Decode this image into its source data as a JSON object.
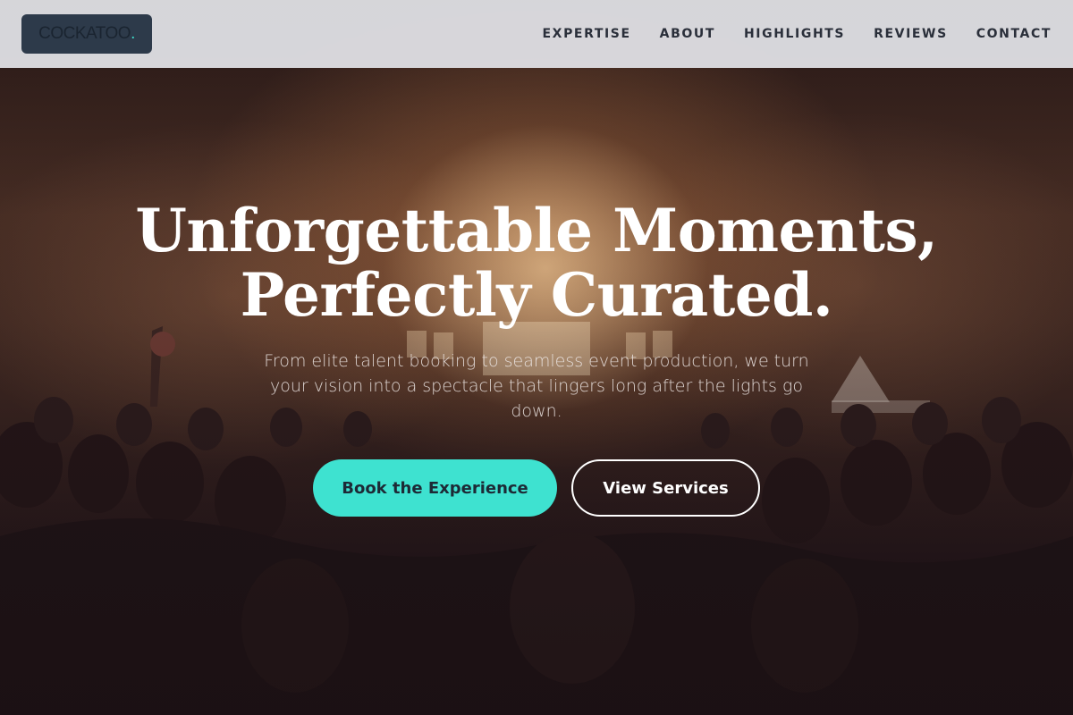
{
  "brand": {
    "logo_text": "COCKATOO",
    "logo_dot": ".",
    "accent_color": "#3ee2d0"
  },
  "nav": {
    "items": [
      {
        "label": "EXPERTISE"
      },
      {
        "label": "ABOUT"
      },
      {
        "label": "HIGHLIGHTS"
      },
      {
        "label": "REVIEWS"
      },
      {
        "label": "CONTACT"
      }
    ]
  },
  "hero": {
    "headline_line1": "Unforgettable Moments,",
    "headline_line2": "Perfectly Curated.",
    "subtext": "From elite talent booking to seamless event production, we turn your vision into a spectacle that lingers long after the lights go down.",
    "primary_button": "Book the Experience",
    "secondary_button": "View Services",
    "background_image": "concert crowd with stage lights"
  }
}
